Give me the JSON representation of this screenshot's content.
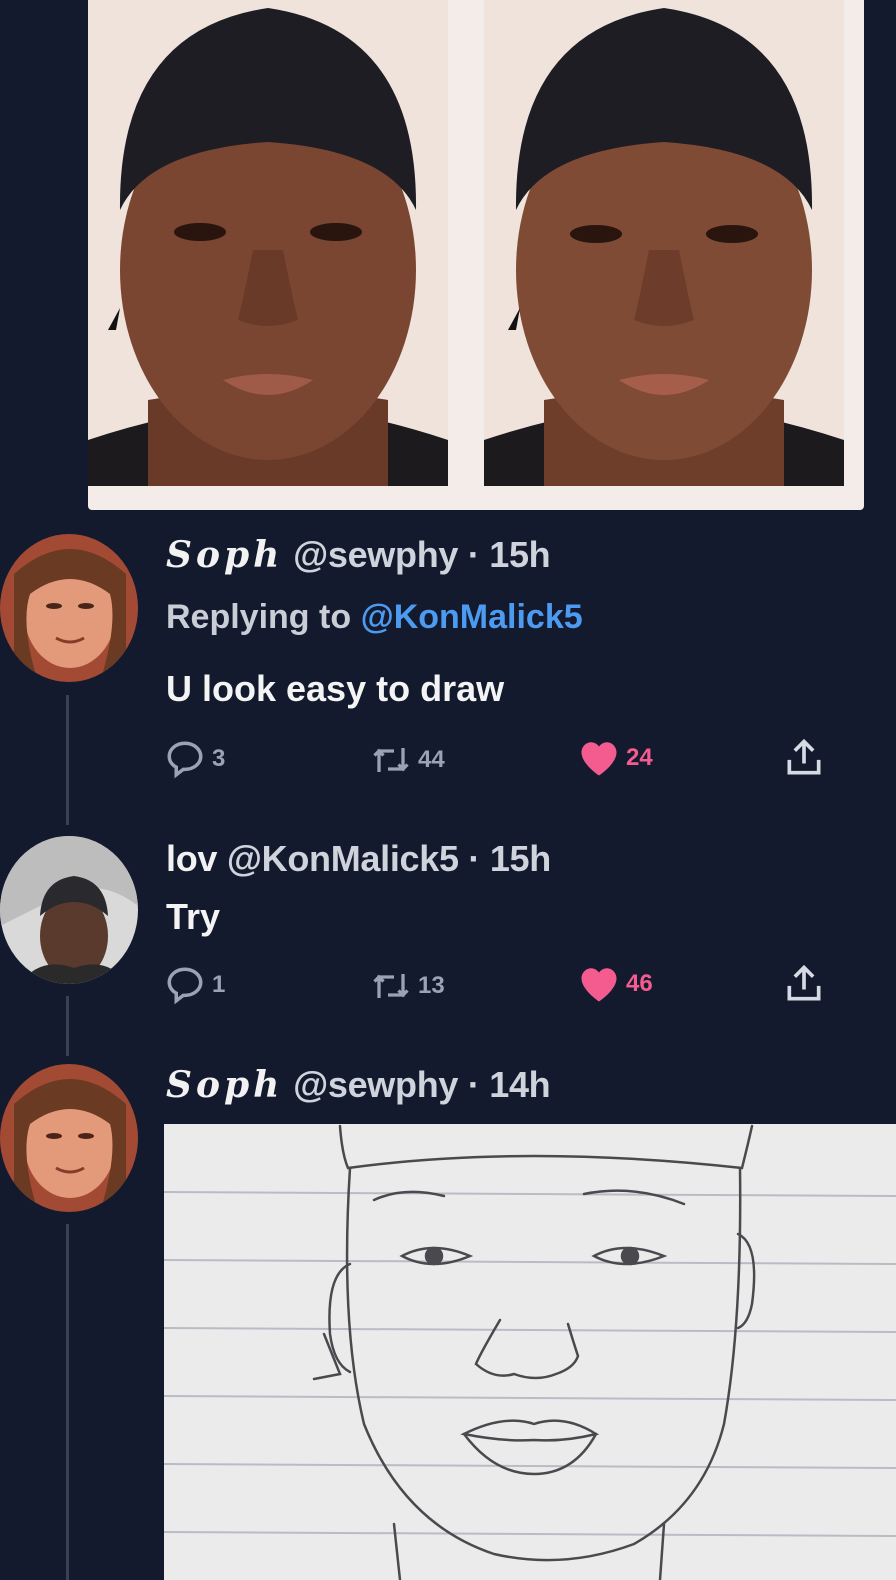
{
  "images": {
    "top_photo": "side-by-side portrait photos",
    "sketch": "pencil sketch of a face on lined paper"
  },
  "tweets": [
    {
      "display_name": "Soph",
      "handle": "@sewphy",
      "dot": "·",
      "time": "15h",
      "replying_prefix": "Replying to",
      "replying_handle": "@KonMalick5",
      "text": "U look easy to draw",
      "replies": "3",
      "retweets": "44",
      "likes": "24"
    },
    {
      "display_name": "lov",
      "handle": "@KonMalick5",
      "dot": "·",
      "time": "15h",
      "text": "Try",
      "replies": "1",
      "retweets": "13",
      "likes": "46"
    },
    {
      "display_name": "Soph",
      "handle": "@sewphy",
      "dot": "·",
      "time": "14h"
    }
  ],
  "icons": {
    "reply": "reply-icon",
    "retweet": "retweet-icon",
    "like": "heart-icon",
    "share": "share-icon"
  },
  "colors": {
    "background": "#141a2e",
    "mention": "#4c9bf0",
    "like": "#f45b8f",
    "muted": "#9aa2b5"
  }
}
